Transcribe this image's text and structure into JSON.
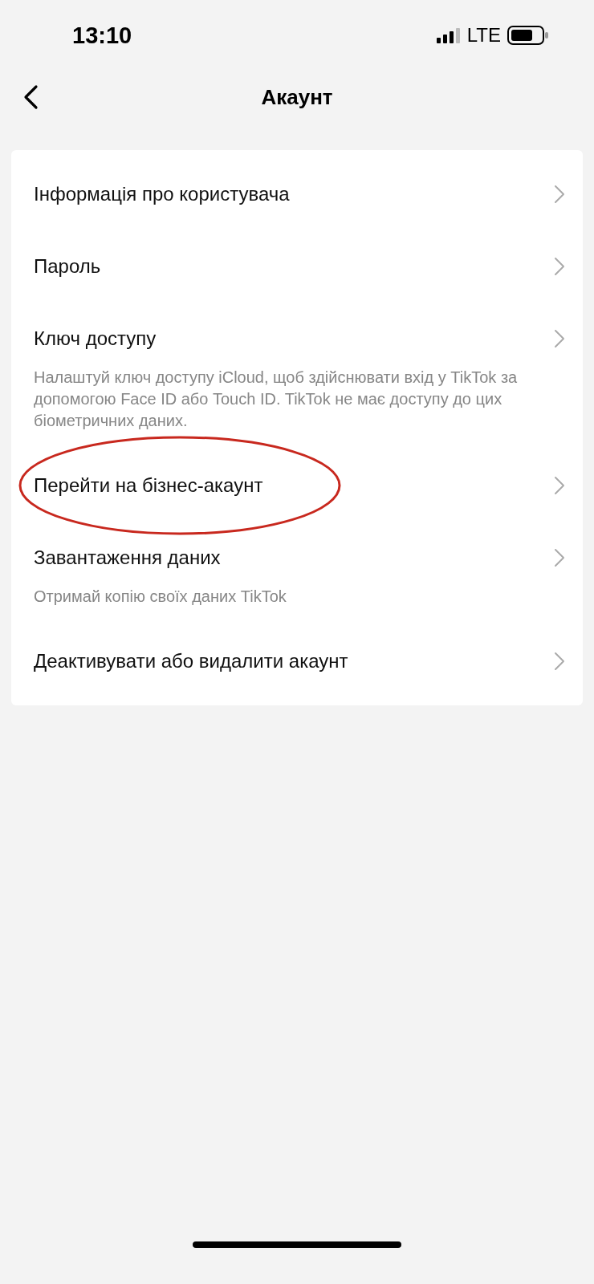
{
  "status_bar": {
    "time": "13:10",
    "network": "LTE"
  },
  "header": {
    "title": "Акаунт"
  },
  "items": [
    {
      "title": "Інформація про користувача",
      "highlighted": false
    },
    {
      "title": "Пароль",
      "highlighted": false
    },
    {
      "title": "Ключ доступу",
      "description": "Налаштуй ключ доступу iCloud, щоб здійснювати вхід у TikTok за допомогою Face ID або Touch ID. TikTok не має доступу до цих біометричних даних.",
      "highlighted": false
    },
    {
      "title": "Перейти на бізнес-акаунт",
      "highlighted": true
    },
    {
      "title": "Завантаження даних",
      "description": "Отримай копію своїх даних TikTok",
      "highlighted": false
    },
    {
      "title": "Деактивувати або видалити акаунт",
      "highlighted": false
    }
  ]
}
